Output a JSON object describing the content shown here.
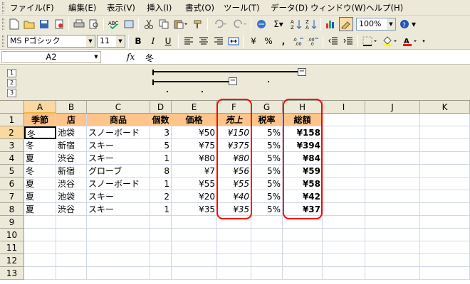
{
  "menu": [
    "ファイル(F)",
    "編集(E)",
    "表示(V)",
    "挿入(I)",
    "書式(O)",
    "ツール(T)",
    "データ(D)",
    "ウィンドウ(W)",
    "ヘルプ(H)"
  ],
  "toolbar1": {
    "zoom": "100%"
  },
  "toolbar2": {
    "font_name": "MS Pゴシック",
    "font_size": "11",
    "bold": "B",
    "italic": "I",
    "underline": "U",
    "currency": "¥",
    "percent": "%",
    "comma": ","
  },
  "formula": {
    "name_box": "A2",
    "fx": "fx",
    "content": "冬"
  },
  "outline": {
    "levels": [
      "1",
      "2",
      "3"
    ]
  },
  "columns": [
    "A",
    "B",
    "C",
    "D",
    "E",
    "F",
    "G",
    "H",
    "I",
    "J",
    "K"
  ],
  "rows": [
    "1",
    "2",
    "3",
    "4",
    "5",
    "6",
    "7",
    "8",
    "9",
    "10",
    "11",
    "12",
    "13"
  ],
  "sheet": {
    "header": [
      "季節",
      "店",
      "商品",
      "個数",
      "価格",
      "売上",
      "税率",
      "総額"
    ],
    "data": [
      [
        "冬",
        "池袋",
        "スノーボード",
        "3",
        "¥50",
        "¥150",
        "5%",
        "¥158"
      ],
      [
        "冬",
        "新宿",
        "スキー",
        "5",
        "¥75",
        "¥375",
        "5%",
        "¥394"
      ],
      [
        "夏",
        "渋谷",
        "スキー",
        "1",
        "¥80",
        "¥80",
        "5%",
        "¥84"
      ],
      [
        "冬",
        "新宿",
        "グローブ",
        "8",
        "¥7",
        "¥56",
        "5%",
        "¥59"
      ],
      [
        "夏",
        "渋谷",
        "スノーボード",
        "1",
        "¥55",
        "¥55",
        "5%",
        "¥58"
      ],
      [
        "夏",
        "池袋",
        "スキー",
        "2",
        "¥20",
        "¥40",
        "5%",
        "¥42"
      ],
      [
        "夏",
        "渋谷",
        "スキー",
        "1",
        "¥35",
        "¥35",
        "5%",
        "¥37"
      ]
    ]
  },
  "colors": {
    "header_fill": "#ffc48a",
    "annotation": "#ff0000",
    "selected_header": "#f9d99f"
  }
}
